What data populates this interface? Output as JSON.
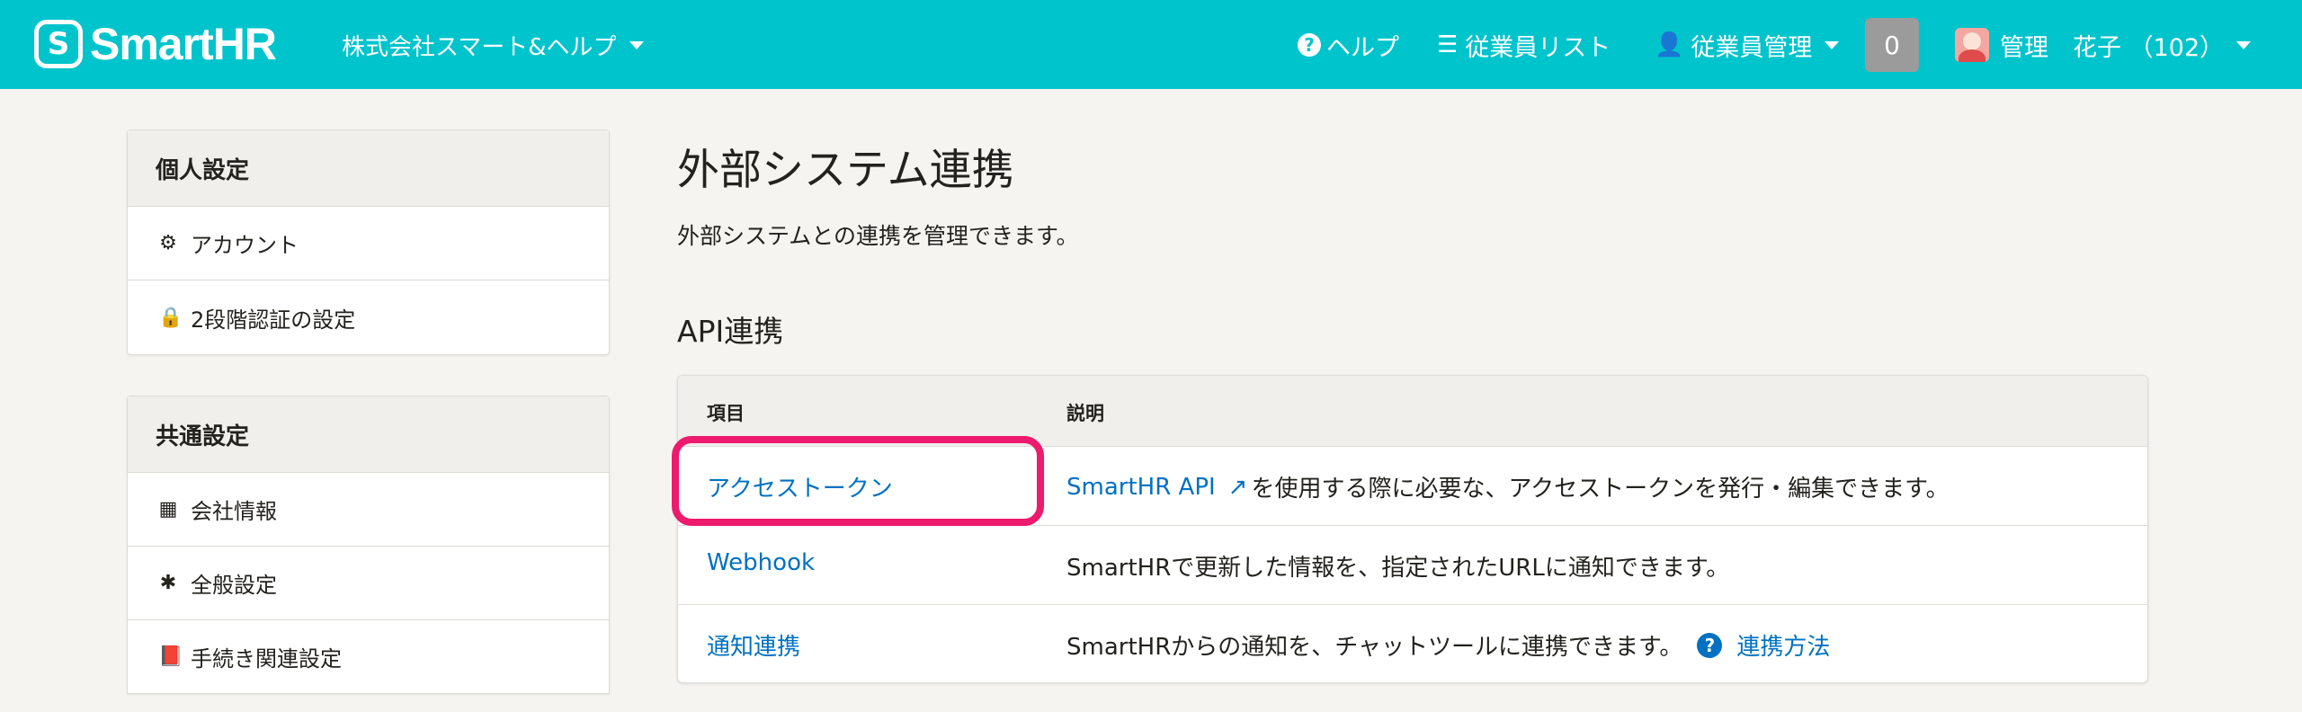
{
  "header": {
    "logo_text": "SmartHR",
    "company": "株式会社スマート&ヘルプ",
    "help": "ヘルプ",
    "employee_list": "従業員リスト",
    "employee_manage": "従業員管理",
    "notification_count": "0",
    "user_name": "管理　花子 （102）"
  },
  "sidebar": {
    "personal": {
      "title": "個人設定",
      "items": [
        {
          "label": "アカウント",
          "icon": "gear-icon"
        },
        {
          "label": "2段階認証の設定",
          "icon": "lock-icon"
        }
      ]
    },
    "common": {
      "title": "共通設定",
      "items": [
        {
          "label": "会社情報",
          "icon": "building-icon"
        },
        {
          "label": "全般設定",
          "icon": "asterisk-icon"
        },
        {
          "label": "手続き関連設定",
          "icon": "book-icon"
        }
      ]
    }
  },
  "main": {
    "title": "外部システム連携",
    "description": "外部システムとの連携を管理できます。",
    "section_title": "API連携",
    "table": {
      "headers": [
        "項目",
        "説明"
      ],
      "rows": [
        {
          "name": "アクセストークン",
          "link": "SmartHR API",
          "desc": "を使用する際に必要な、アクセストークンを発行・編集できます。"
        },
        {
          "name": "Webhook",
          "desc": "SmartHRで更新した情報を、指定されたURLに通知できます。"
        },
        {
          "name": "通知連携",
          "desc": "SmartHRからの通知を、チャットツールに連携できます。",
          "help_link": "連携方法"
        }
      ]
    }
  },
  "colors": {
    "brand": "#00c4cc",
    "link": "#0071c1",
    "highlight": "#ee1a6d"
  }
}
